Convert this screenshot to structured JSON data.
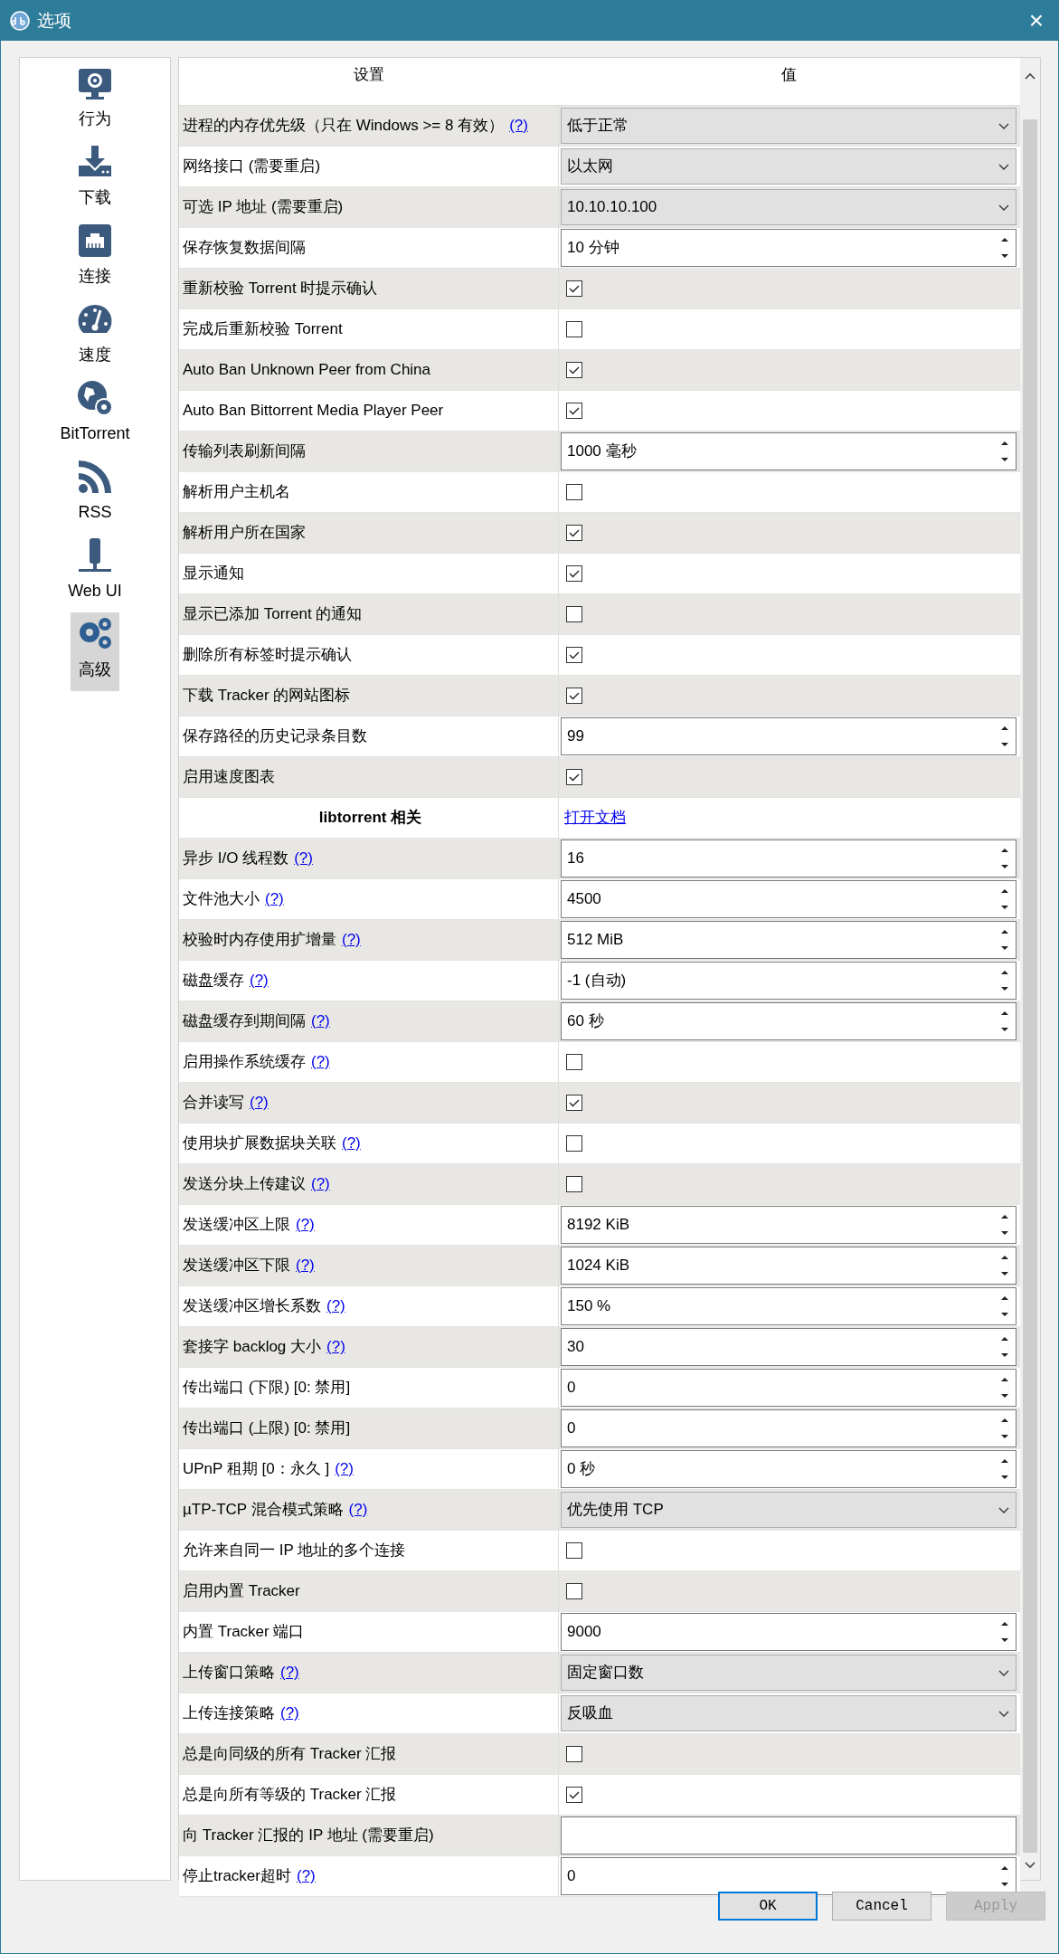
{
  "window": {
    "title": "选项",
    "close": "×"
  },
  "sidebar": {
    "items": [
      {
        "label": "行为",
        "selected": false
      },
      {
        "label": "下载",
        "selected": false
      },
      {
        "label": "连接",
        "selected": false
      },
      {
        "label": "速度",
        "selected": false
      },
      {
        "label": "BitTorrent",
        "selected": false
      },
      {
        "label": "RSS",
        "selected": false
      },
      {
        "label": "Web UI",
        "selected": false
      },
      {
        "label": "高级",
        "selected": true
      }
    ]
  },
  "table": {
    "columns": [
      "设置",
      "值"
    ],
    "rows": [
      {
        "kind": "combo",
        "label": "进程的内存优先级（只在 Windows >= 8 有效）",
        "help": "(?)",
        "value": "低于正常"
      },
      {
        "kind": "combo",
        "label": "网络接口 (需要重启)",
        "value": "以太网"
      },
      {
        "kind": "combo",
        "label": "可选 IP 地址 (需要重启)",
        "value": "10.10.10.100"
      },
      {
        "kind": "spin",
        "label": "保存恢复数据间隔",
        "value": "10 分钟"
      },
      {
        "kind": "check",
        "label": "重新校验 Torrent 时提示确认",
        "checked": true
      },
      {
        "kind": "check",
        "label": "完成后重新校验 Torrent",
        "checked": false
      },
      {
        "kind": "check",
        "label": "Auto Ban Unknown Peer from China",
        "checked": true
      },
      {
        "kind": "check",
        "label": "Auto Ban Bittorrent Media Player Peer",
        "checked": true
      },
      {
        "kind": "spin",
        "label": "传输列表刷新间隔",
        "value": "1000 毫秒"
      },
      {
        "kind": "check",
        "label": "解析用户主机名",
        "checked": false
      },
      {
        "kind": "check",
        "label": "解析用户所在国家",
        "checked": true
      },
      {
        "kind": "check",
        "label": "显示通知",
        "checked": true
      },
      {
        "kind": "check",
        "label": "显示已添加 Torrent 的通知",
        "checked": false
      },
      {
        "kind": "check",
        "label": "删除所有标签时提示确认",
        "checked": true
      },
      {
        "kind": "check",
        "label": "下载 Tracker 的网站图标",
        "checked": true
      },
      {
        "kind": "spin",
        "label": "保存路径的历史记录条目数",
        "value": "99"
      },
      {
        "kind": "check",
        "label": "启用速度图表",
        "checked": true
      },
      {
        "kind": "header",
        "label": "libtorrent 相关",
        "link": "打开文档"
      },
      {
        "kind": "spin",
        "label": "异步 I/O 线程数",
        "help": "(?)",
        "value": "16"
      },
      {
        "kind": "spin",
        "label": "文件池大小",
        "help": "(?)",
        "value": "4500"
      },
      {
        "kind": "spin",
        "label": "校验时内存使用扩增量",
        "help": "(?)",
        "value": "512 MiB"
      },
      {
        "kind": "spin",
        "label": "磁盘缓存",
        "help": "(?)",
        "value": "-1 (自动)"
      },
      {
        "kind": "spin",
        "label": "磁盘缓存到期间隔",
        "help": "(?)",
        "value": "60 秒"
      },
      {
        "kind": "check",
        "label": "启用操作系统缓存",
        "help": "(?)",
        "checked": false
      },
      {
        "kind": "check",
        "label": "合并读写",
        "help": "(?)",
        "checked": true
      },
      {
        "kind": "check",
        "label": "使用块扩展数据块关联",
        "help": "(?)",
        "checked": false
      },
      {
        "kind": "check",
        "label": "发送分块上传建议",
        "help": "(?)",
        "checked": false
      },
      {
        "kind": "spin",
        "label": "发送缓冲区上限",
        "help": "(?)",
        "value": "8192 KiB"
      },
      {
        "kind": "spin",
        "label": "发送缓冲区下限",
        "help": "(?)",
        "value": "1024 KiB"
      },
      {
        "kind": "spin",
        "label": "发送缓冲区增长系数",
        "help": "(?)",
        "value": "150 %"
      },
      {
        "kind": "spin",
        "label": "套接字 backlog 大小",
        "help": "(?)",
        "value": "30"
      },
      {
        "kind": "spin",
        "label": "传出端口 (下限) [0: 禁用]",
        "value": "0"
      },
      {
        "kind": "spin",
        "label": "传出端口 (上限) [0: 禁用]",
        "value": "0"
      },
      {
        "kind": "spin",
        "label": "UPnP 租期 [0：永久 ]",
        "help": "(?)",
        "value": "0 秒"
      },
      {
        "kind": "combo",
        "label": "µTP-TCP 混合模式策略",
        "help": "(?)",
        "value": "优先使用 TCP"
      },
      {
        "kind": "check",
        "label": "允许来自同一 IP 地址的多个连接",
        "checked": false
      },
      {
        "kind": "check",
        "label": "启用内置 Tracker",
        "checked": false
      },
      {
        "kind": "spin",
        "label": "内置 Tracker 端口",
        "value": "9000"
      },
      {
        "kind": "combo",
        "label": "上传窗口策略",
        "help": "(?)",
        "value": "固定窗口数"
      },
      {
        "kind": "combo",
        "label": "上传连接策略",
        "help": "(?)",
        "value": "反吸血"
      },
      {
        "kind": "check",
        "label": "总是向同级的所有 Tracker 汇报",
        "checked": false
      },
      {
        "kind": "check",
        "label": "总是向所有等级的 Tracker 汇报",
        "checked": true
      },
      {
        "kind": "text",
        "label": "向 Tracker 汇报的 IP 地址 (需要重启)"
      },
      {
        "kind": "spin",
        "label": "停止tracker超时",
        "help": "(?)",
        "value": "0"
      }
    ]
  },
  "buttons": [
    {
      "label": "OK",
      "default": true,
      "disabled": false
    },
    {
      "label": "Cancel",
      "default": false,
      "disabled": false
    },
    {
      "label": "Apply",
      "default": false,
      "disabled": true
    }
  ]
}
